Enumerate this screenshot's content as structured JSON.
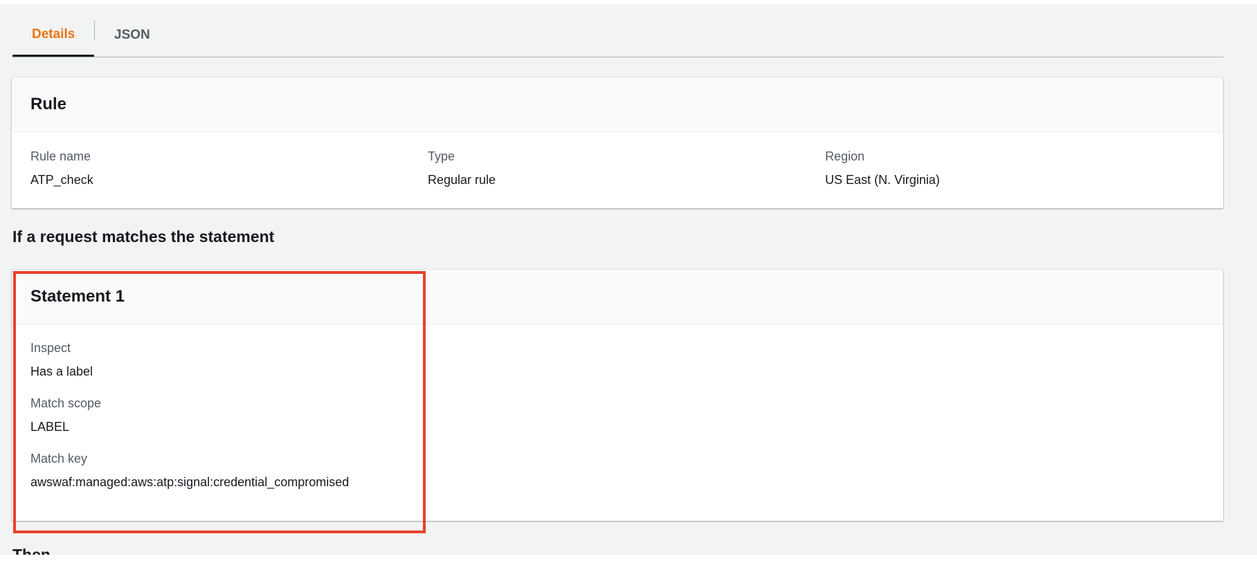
{
  "tabs": [
    {
      "label": "Details",
      "active": true
    },
    {
      "label": "JSON",
      "active": false
    }
  ],
  "rule_panel": {
    "title": "Rule",
    "fields": [
      {
        "label": "Rule name",
        "value": "ATP_check"
      },
      {
        "label": "Type",
        "value": "Regular rule"
      },
      {
        "label": "Region",
        "value": "US East (N. Virginia)"
      }
    ]
  },
  "statement_section": {
    "title": "If a request matches the statement"
  },
  "statement_panel": {
    "title": "Statement 1",
    "fields": [
      {
        "label": "Inspect",
        "value": "Has a label"
      },
      {
        "label": "Match scope",
        "value": "LABEL"
      },
      {
        "label": "Match key",
        "value": "awswaf:managed:aws:atp:signal:credential_compromised"
      }
    ]
  },
  "then_section": {
    "title": "Then"
  },
  "colors": {
    "active_tab": "#ec7211",
    "highlight_border": "#e8412c",
    "page_background": "#f2f3f3"
  }
}
